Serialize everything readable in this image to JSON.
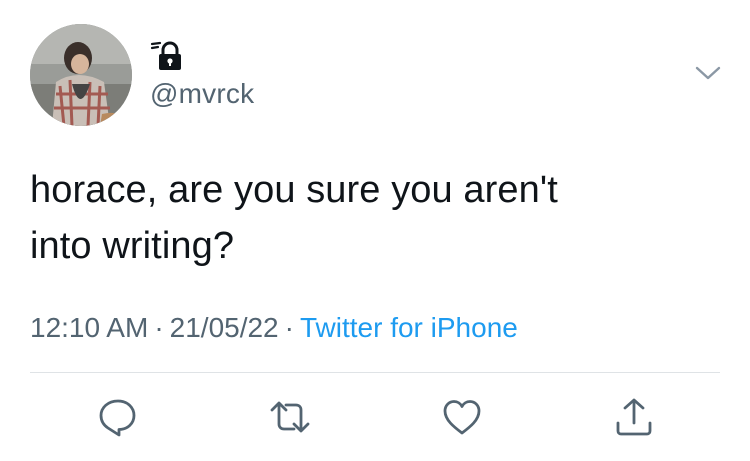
{
  "tweet": {
    "handle": "@mvrck",
    "text_line1": "horace, are you sure you aren't",
    "text_line2": "into writing?",
    "time": "12:10 AM",
    "date": "21/05/22",
    "separator": "·",
    "source": "Twitter for iPhone"
  },
  "icons": {
    "avatar": "profile-photo",
    "display_name": "lock-icon",
    "menu": "chevron-down-icon",
    "actions": [
      "reply-icon",
      "retweet-icon",
      "like-icon",
      "share-icon"
    ]
  },
  "colors": {
    "text": "#0f1419",
    "secondary": "#536471",
    "link": "#1d9bf0",
    "divider": "#dfe3e6"
  }
}
